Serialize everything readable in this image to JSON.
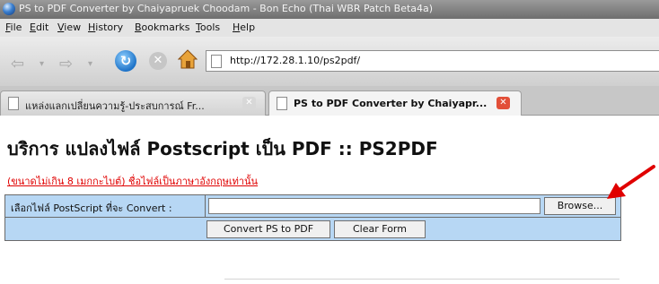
{
  "window": {
    "title": "PS to PDF Converter by Chaiyapruek Choodam - Bon Echo (Thai WBR Patch Beta4a)"
  },
  "menu": {
    "items": [
      "File",
      "Edit",
      "View",
      "History",
      "Bookmarks",
      "Tools",
      "Help"
    ]
  },
  "navigation": {
    "url": "http://172.28.1.10/ps2pdf/"
  },
  "tabs": [
    {
      "label": "แหล่งแลกเปลี่ยนความรู้-ประสบการณ์ Fr..."
    },
    {
      "label": "PS to PDF Converter by Chaiyapr..."
    }
  ],
  "page": {
    "title": "บริการ แปลงไฟล์ Postscript เป็น PDF :: PS2PDF",
    "notice": "(ขนาดไม่เกิน 8 เมกกะไบต์) ชื่อไฟล์เป็นภาษาอังกฤษเท่านั้น",
    "file_label": "เลือกไฟล์ PostScript ที่จะ Convert :",
    "file_value": "",
    "browse_label": "Browse...",
    "convert_label": "Convert PS to PDF",
    "clear_label": "Clear Form"
  },
  "colors": {
    "form_background": "#b7d7f4",
    "notice_text": "#e00000",
    "annotation_arrow": "#e00000"
  }
}
